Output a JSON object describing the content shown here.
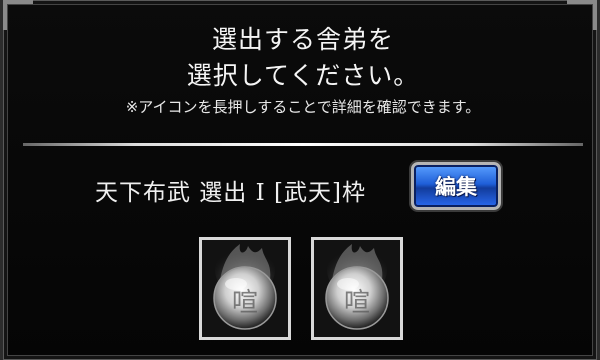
{
  "instruction": {
    "line1": "選出する舎弟を",
    "line2": "選択してください。",
    "note": "※アイコンを長押しすることで詳細を確認できます。"
  },
  "selection": {
    "title": "天下布武 選出 I [武天]枠",
    "edit_label": "編集"
  },
  "slots": [
    {
      "emblem_char": "喧",
      "icon": "empty-slot-orb-icon"
    },
    {
      "emblem_char": "喧",
      "icon": "empty-slot-orb-icon"
    }
  ],
  "colors": {
    "background": "#000000",
    "edit_button": "#1f5fd8",
    "slot_border": "#d9d9d9"
  }
}
